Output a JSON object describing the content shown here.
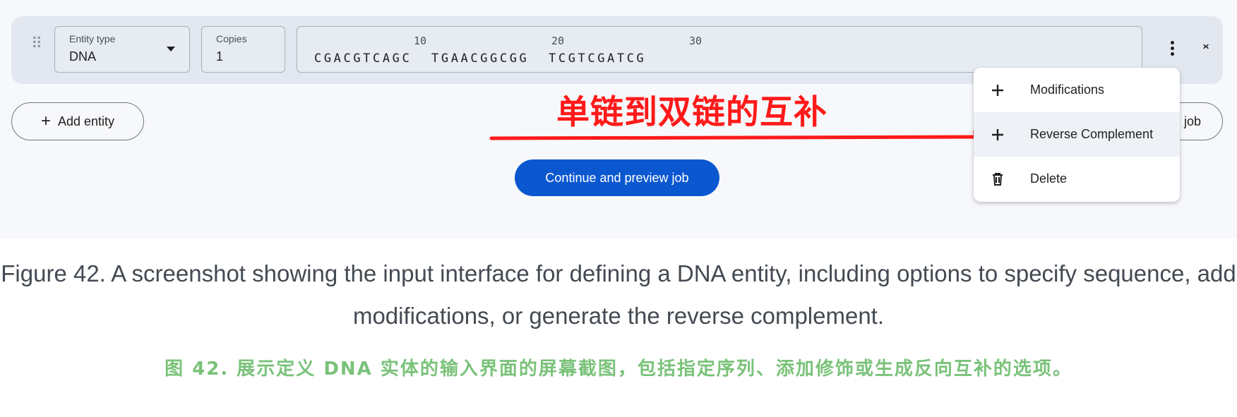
{
  "entity": {
    "type_label": "Entity type",
    "type_value": "DNA",
    "copies_label": "Copies",
    "copies_value": "1",
    "ruler": [
      "10",
      "20",
      "30"
    ],
    "sequence": "CGACGTCAGC  TGAACGGCGG  TCGTCGATCG"
  },
  "buttons": {
    "add_entity": "Add entity",
    "continue": "Continue and preview job",
    "job_fragment": "job"
  },
  "menu": {
    "items": [
      {
        "label": "Modifications",
        "icon": "plus-icon"
      },
      {
        "label": "Reverse Complement",
        "icon": "plus-icon"
      },
      {
        "label": "Delete",
        "icon": "trash-icon"
      }
    ]
  },
  "annotation": {
    "text": "单链到双链的互补",
    "color": "#ff1a1a"
  },
  "caption": {
    "english": "Figure 42. A screenshot showing the input interface for defining a DNA entity, including options to specify sequence, add modifications, or generate the reverse complement.",
    "chinese": "图 42. 展示定义 DNA 实体的输入界面的屏幕截图，包括指定序列、添加修饰或生成反向互补的选项。"
  },
  "colors": {
    "primary": "#0b57d0",
    "panel": "#f7f8fb",
    "row": "#e2e7f0",
    "caption_cn": "#7ac27a"
  }
}
